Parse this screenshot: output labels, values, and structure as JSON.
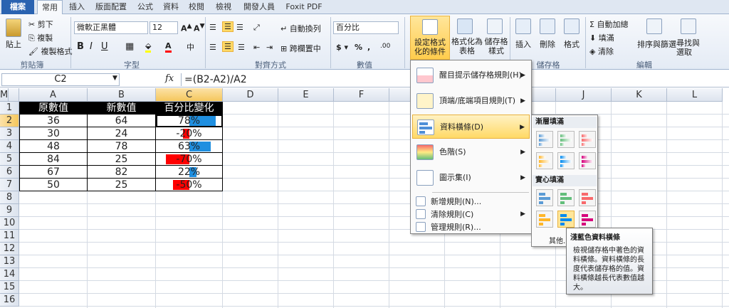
{
  "tabs": [
    "檔案",
    "常用",
    "插入",
    "版面配置",
    "公式",
    "資料",
    "校閱",
    "檢視",
    "開發人員",
    "Foxit PDF"
  ],
  "ribbon": {
    "clipboard": {
      "paste": "貼上",
      "cut": "剪下",
      "copy": "複製",
      "format_painter": "複製格式",
      "label": "剪貼簿"
    },
    "font": {
      "name": "微軟正黑體",
      "size": "12",
      "label": "字型"
    },
    "alignment": {
      "wrap": "自動換列",
      "merge": "跨欄置中",
      "label": "對齊方式"
    },
    "number": {
      "format": "百分比",
      "label": "數值"
    },
    "styles": {
      "conditional": "設定格式化的條件",
      "format_table": "格式化為表格",
      "cell_styles": "儲存格樣式"
    },
    "cells": {
      "insert": "插入",
      "delete": "刪除",
      "format": "格式",
      "label": "儲存格"
    },
    "editing": {
      "autosum": "自動加總",
      "fill": "填滿",
      "clear": "清除",
      "sort": "排序與篩選",
      "find": "尋找與選取",
      "label": "編輯"
    }
  },
  "formula_bar": {
    "name_box": "C2",
    "fx": "fx",
    "formula": "=(B2-A2)/A2"
  },
  "columns": [
    "A",
    "B",
    "C",
    "D",
    "E",
    "F",
    "G",
    "H",
    "I",
    "J",
    "K",
    "L",
    "M"
  ],
  "rows": [
    "1",
    "2",
    "3",
    "4",
    "5",
    "6",
    "7",
    "8",
    "9",
    "10",
    "11",
    "12",
    "13",
    "14",
    "15",
    "16"
  ],
  "table": {
    "headers": [
      "原數值",
      "新數值",
      "百分比變化"
    ],
    "data": [
      {
        "a": "36",
        "b": "64",
        "c": "78%",
        "pct": 0.78
      },
      {
        "a": "30",
        "b": "24",
        "c": "-20%",
        "pct": -0.2
      },
      {
        "a": "48",
        "b": "78",
        "c": "63%",
        "pct": 0.63
      },
      {
        "a": "84",
        "b": "25",
        "c": "-70%",
        "pct": -0.7
      },
      {
        "a": "67",
        "b": "82",
        "c": "22%",
        "pct": 0.22
      },
      {
        "a": "50",
        "b": "25",
        "c": "-50%",
        "pct": -0.5
      }
    ]
  },
  "menu": {
    "items": [
      "醒目提示儲存格規則(H)",
      "頂端/底端項目規則(T)",
      "資料橫條(D)",
      "色階(S)",
      "圖示集(I)"
    ],
    "sub_items": [
      "新增規則(N)...",
      "清除規則(C)",
      "管理規則(R)..."
    ]
  },
  "submenu": {
    "gradient": "漸層填滿",
    "solid": "實心填滿",
    "other": "其他"
  },
  "tooltip": {
    "title": "淺藍色資料橫條",
    "body": "檢視儲存格中著色的資料橫條。資料橫條的長度代表儲存格的值。資料橫條越長代表數值越大。"
  },
  "colors": {
    "positive_bar": "#1f8fe0",
    "negative_bar": "#ff0000",
    "highlight": "#ffd966"
  }
}
